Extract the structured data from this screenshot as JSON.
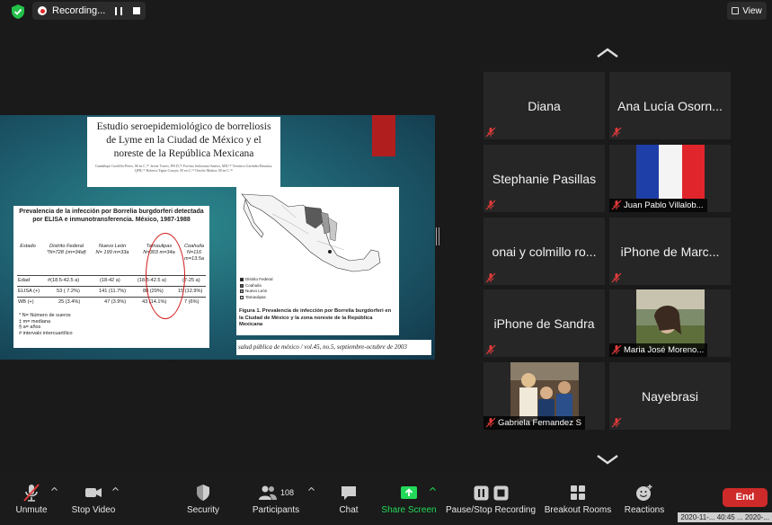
{
  "top_bar": {
    "recording_label": "Recording...",
    "view_label": "View"
  },
  "shared_screen": {
    "paper_title": "Estudio seroepidemiológico de borreliosis de Lyme en la Ciudad de México y el noreste de la República Mexicana",
    "paper_authors": "Guadalupe Gordillo-Pérez, M en C,⁽¹⁾ Javier Torres, PH D,⁽¹⁾ Fortino Solórzano-Santos, MD,⁽²⁾ Verónica Garduño-Bautista, QFB,⁽¹⁾ Roberto Tapia-Conyer, M en C,⁽³⁾ Onofre Muñoz, M en C.⁽¹⁾",
    "table": {
      "title": "Prevalencia de la infección por Borrelia burgdorferi detectada por ELISA e inmunotransferencia. México, 1987-1988",
      "columns": [
        {
          "name": "Estado",
          "sub": ""
        },
        {
          "name": "Distrito Federal",
          "sub": "*N=728 ‡m=34a§"
        },
        {
          "name": "Nuevo León",
          "sub": "N= 199 m=33a"
        },
        {
          "name": "Tamaulipas",
          "sub": "N=303 m=34a"
        },
        {
          "name": "Coahuila",
          "sub": "N=116 m=13.5a"
        }
      ],
      "rows": [
        {
          "label": "Edad",
          "cells": [
            "#(18.5-42.5 a)",
            "(18-42 a)",
            "(18.5-42.5 a)",
            "(7-25 a)"
          ]
        },
        {
          "label": "ELISA (+)",
          "cells": [
            "53 ( 7.2%)",
            "141 (11.7%)",
            "88 (29%)",
            "15 (12.9%)"
          ]
        },
        {
          "label": "WB (+)",
          "cells": [
            "25 (3.4%)",
            "47 (3.9%)",
            "43 (14.1%)",
            "7 (6%)"
          ]
        }
      ],
      "notes": [
        "* N= Número de sueros",
        "‡ m= mediana",
        "§ a= años",
        "# intervalo intercuartílico"
      ]
    },
    "map": {
      "legend": [
        "Distrito Federal",
        "Coahuila",
        "Nuevo León",
        "Tamaulipas"
      ],
      "legend_colors": [
        "#222222",
        "#5a5a5a",
        "#9a9a9a",
        "#c8c8c8"
      ],
      "caption": "Figura 1. Prevalencia de infección por Borrelia burgdorferi en la Ciudad de México y la zona noreste de la República Mexicana"
    },
    "journal_footer": "salud pública de méxico / vol.45, no.5, septiembre-octubre de 2003"
  },
  "participants": [
    {
      "name": "Diana",
      "video": false
    },
    {
      "name": "Ana Lucía Osorn...",
      "video": false
    },
    {
      "name": "Stephanie Pasillas",
      "video": false
    },
    {
      "name": "Juan Pablo Villalob...",
      "video": true
    },
    {
      "name": "onai y colmillo ro...",
      "video": false
    },
    {
      "name": "iPhone de Marc...",
      "video": false
    },
    {
      "name": "iPhone de Sandra",
      "video": false
    },
    {
      "name": "Maria José Moreno...",
      "video": true
    },
    {
      "name": "Gabriela Fernandez S",
      "video": true
    },
    {
      "name": "Nayebrasi",
      "video": false
    }
  ],
  "toolbar": {
    "unmute": "Unmute",
    "stop_video": "Stop Video",
    "security": "Security",
    "participants": "Participants",
    "participants_count": "108",
    "chat": "Chat",
    "share_screen": "Share Screen",
    "pause_stop_recording": "Pause/Stop Recording",
    "breakout_rooms": "Breakout Rooms",
    "reactions": "Reactions",
    "end": "End"
  },
  "timestamp": "2020-11-... 40:45 ... 2020-...",
  "colors": {
    "share_green": "#23d959",
    "end_red": "#cf2a2a",
    "recording_red": "#e02828",
    "mic_off_red": "#e23b3b"
  }
}
